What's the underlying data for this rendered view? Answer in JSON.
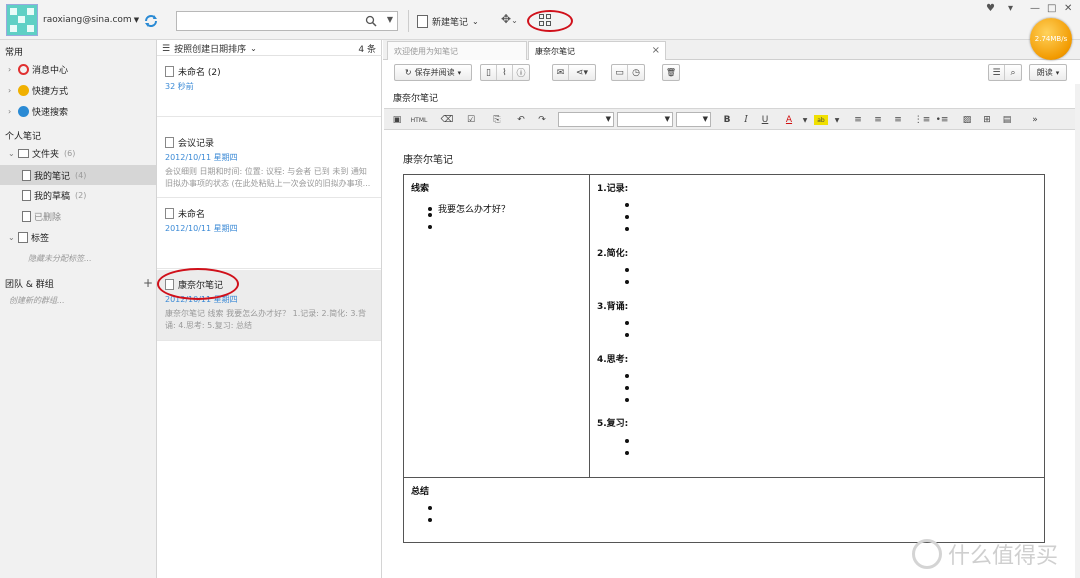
{
  "account": {
    "email": "raoxiang@sina.com"
  },
  "search": {
    "placeholder": ""
  },
  "toolbar": {
    "new_note": "新建笔记"
  },
  "speed": {
    "text": "2.74MB/s"
  },
  "sidebar": {
    "section_common": "常用",
    "common_items": [
      {
        "label": "消息中心",
        "icon": "bell-icon",
        "color": "#e03030"
      },
      {
        "label": "快捷方式",
        "icon": "bolt-icon",
        "color": "#f0b000"
      },
      {
        "label": "快速搜索",
        "icon": "search-icon",
        "color": "#2a8ad4"
      }
    ],
    "section_personal": "个人笔记",
    "folder": {
      "label": "文件夹",
      "count": "(6)"
    },
    "my_notes": {
      "label": "我的笔记",
      "count": "(4)"
    },
    "drafts": {
      "label": "我的草稿",
      "count": "(2)"
    },
    "deleted": {
      "label": "已删除"
    },
    "tags": {
      "label": "标签"
    },
    "tags_hint": "隐藏未分配标签...",
    "section_team": "团队 & 群组",
    "team_hint": "创建新的群组..."
  },
  "notelist": {
    "sort_label": "按照创建日期排序",
    "count": "4 条",
    "notes": [
      {
        "title": "未命名 (2)",
        "date": "32 秒前",
        "preview": ""
      },
      {
        "title": "会议记录",
        "date": "2012/10/11 星期四",
        "preview": "会议细则 日期和时间: 位置: 议程: 与会者 已到 未到 通知 旧拟办事项的状态 (在此处粘贴上一次会议的旧拟办事项..."
      },
      {
        "title": "未命名",
        "date": "2012/10/11 星期四",
        "preview": ""
      },
      {
        "title": "康奈尔笔记",
        "date": "2012/10/11 星期四",
        "preview": "康奈尔笔记 线索 我要怎么办才好？ 1.记录: 2.简化: 3.背诵: 4.思考: 5.复习: 总结"
      }
    ]
  },
  "editor": {
    "tabs": [
      {
        "label": "欢迎使用为知笔记"
      },
      {
        "label": "康奈尔笔记"
      }
    ],
    "save_read": "保存并阅读",
    "read_label": "朗读",
    "note_title": "康奈尔笔记",
    "html_label": "HTML",
    "font_color": "#d01010",
    "highlight_color": "#f0e000"
  },
  "document": {
    "title": "康奈尔笔记",
    "cue_heading": "线索",
    "cue_question": "我要怎么办才好？",
    "sections": [
      "1.记录:",
      "2.简化:",
      "3.背诵:",
      "4.思考:",
      "5.复习:"
    ],
    "summary_heading": "总结"
  },
  "watermark": {
    "text": "什么值得买"
  }
}
